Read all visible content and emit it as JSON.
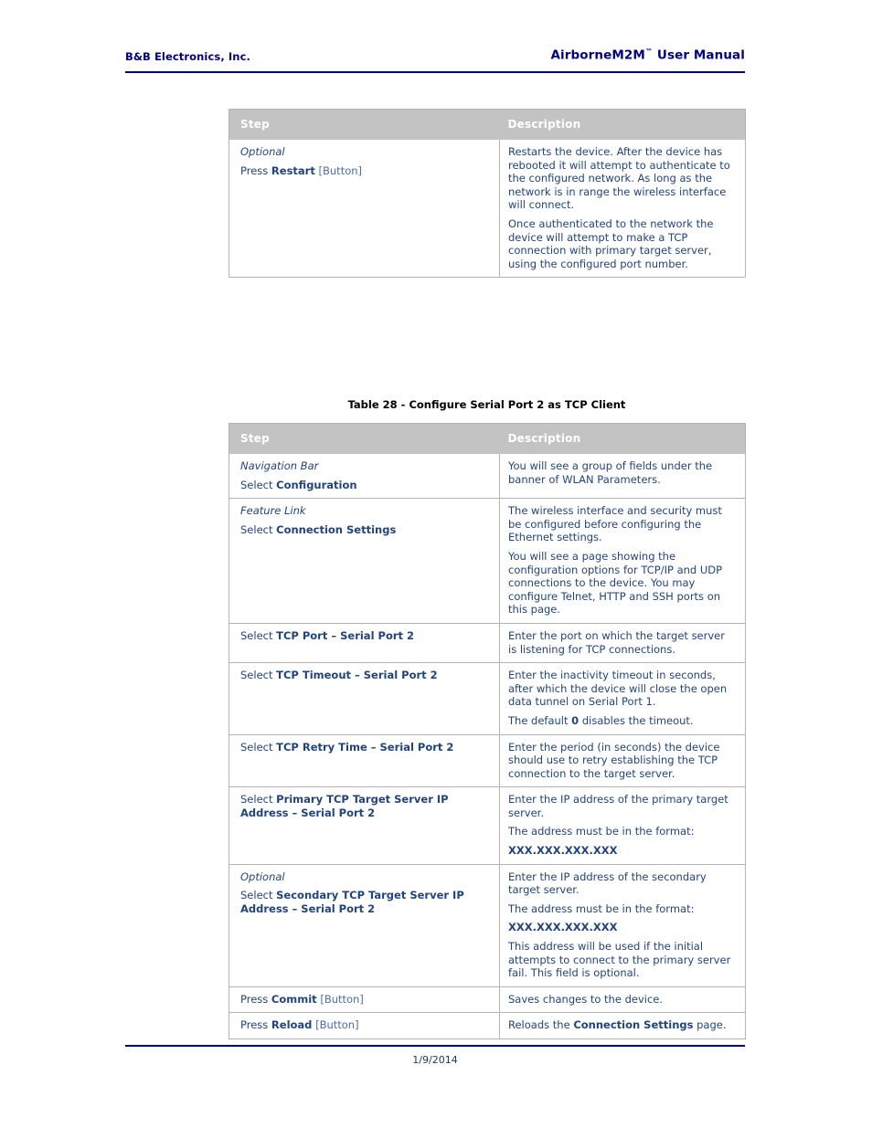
{
  "header": {
    "company": "B&B Electronics, Inc.",
    "manual_title": "AirborneM2M",
    "manual_title_tm": "™",
    "manual_title_rest": " User Manual"
  },
  "footer": {
    "date": "1/9/2014"
  },
  "tables": [
    {
      "id": "table-restart",
      "caption": null,
      "columns": [
        "Step",
        "Description"
      ],
      "rows": [
        {
          "step": {
            "line1_italic": "Optional",
            "line2_prefix": "Press ",
            "line2_bold": "Restart",
            "line2_suffix": " [Button]"
          },
          "description": [
            "Restarts the device. After the device has rebooted it will attempt to authenticate to the configured network. As long as the network is in range the wireless interface will connect.",
            "Once authenticated to the network the device will attempt to make a TCP connection with primary target server, using the configured port number."
          ]
        }
      ]
    },
    {
      "id": "table-tcpclient",
      "caption": "Table 28 - Configure Serial Port 2 as TCP Client",
      "columns": [
        "Step",
        "Description"
      ],
      "rows": [
        {
          "step": {
            "line1_italic": "Navigation Bar",
            "line2_prefix": "Select ",
            "line2_bold": "Configuration",
            "line2_suffix": ""
          },
          "description": [
            "You will see a group of fields under the banner of WLAN Parameters."
          ]
        },
        {
          "step": {
            "line1_italic": "Feature Link",
            "line2_prefix": "Select ",
            "line2_bold": "Connection Settings",
            "line2_suffix": ""
          },
          "description": [
            "The wireless interface and security must be configured before configuring the Ethernet settings.",
            "You will see a page showing the configuration options for TCP/IP and UDP connections to the device. You may configure Telnet, HTTP and SSH ports on this page."
          ]
        },
        {
          "step": {
            "line1_italic": "",
            "line2_prefix": "Select ",
            "line2_bold": "TCP Port – Serial Port 2",
            "line2_suffix": ""
          },
          "description": [
            "Enter the port on which the target server is listening for TCP connections."
          ]
        },
        {
          "step": {
            "line1_italic": "",
            "line2_prefix": "Select ",
            "line2_bold": "TCP Timeout – Serial Port 2",
            "line2_suffix": ""
          },
          "description": [
            "Enter the inactivity timeout in seconds, after which the device will close the open data tunnel on Serial Port 1.",
            "The default 0 disables the timeout."
          ],
          "description_bold_tokens": [
            "0"
          ]
        },
        {
          "step": {
            "line1_italic": "",
            "line2_prefix": "Select ",
            "line2_bold": "TCP Retry Time – Serial Port 2",
            "line2_suffix": ""
          },
          "description": [
            "Enter the period (in seconds) the device should use to retry establishing the TCP connection to the target server."
          ]
        },
        {
          "step": {
            "line1_italic": "",
            "line2_prefix": "Select ",
            "line2_bold": "Primary TCP Target Server IP Address – Serial Port 2",
            "line2_suffix": ""
          },
          "description": [
            "Enter the IP address of the primary target server.",
            "The address must be in the format:",
            "XXX.XXX.XXX.XXX"
          ],
          "description_last_bold": true
        },
        {
          "step": {
            "line1_italic": "Optional",
            "line2_prefix": "Select ",
            "line2_bold": "Secondary TCP Target Server IP Address – Serial Port 2",
            "line2_suffix": ""
          },
          "description": [
            "Enter the IP address of the secondary target server.",
            "The address must be in the format:",
            "XXX.XXX.XXX.XXX",
            "This address will be used if the initial attempts to connect to the primary server fail. This field is optional."
          ]
        },
        {
          "step": {
            "line1_italic": "",
            "line2_prefix": "Press ",
            "line2_bold": "Commit",
            "line2_suffix": " [Button]"
          },
          "description": [
            "Saves changes to the device."
          ]
        },
        {
          "step": {
            "line1_italic": "",
            "line2_prefix": "Press ",
            "line2_bold": "Reload",
            "line2_suffix": " [Button]"
          },
          "description": [
            "Reloads the Connection Settings page."
          ],
          "description_bold_tokens": [
            "Connection Settings"
          ]
        }
      ]
    }
  ],
  "colors": {
    "navy": "#000080",
    "body_text": "#22447c",
    "table_header_bg": "#c3c3c3",
    "table_border": "#b3b3b3",
    "caption_text": "#000000"
  }
}
